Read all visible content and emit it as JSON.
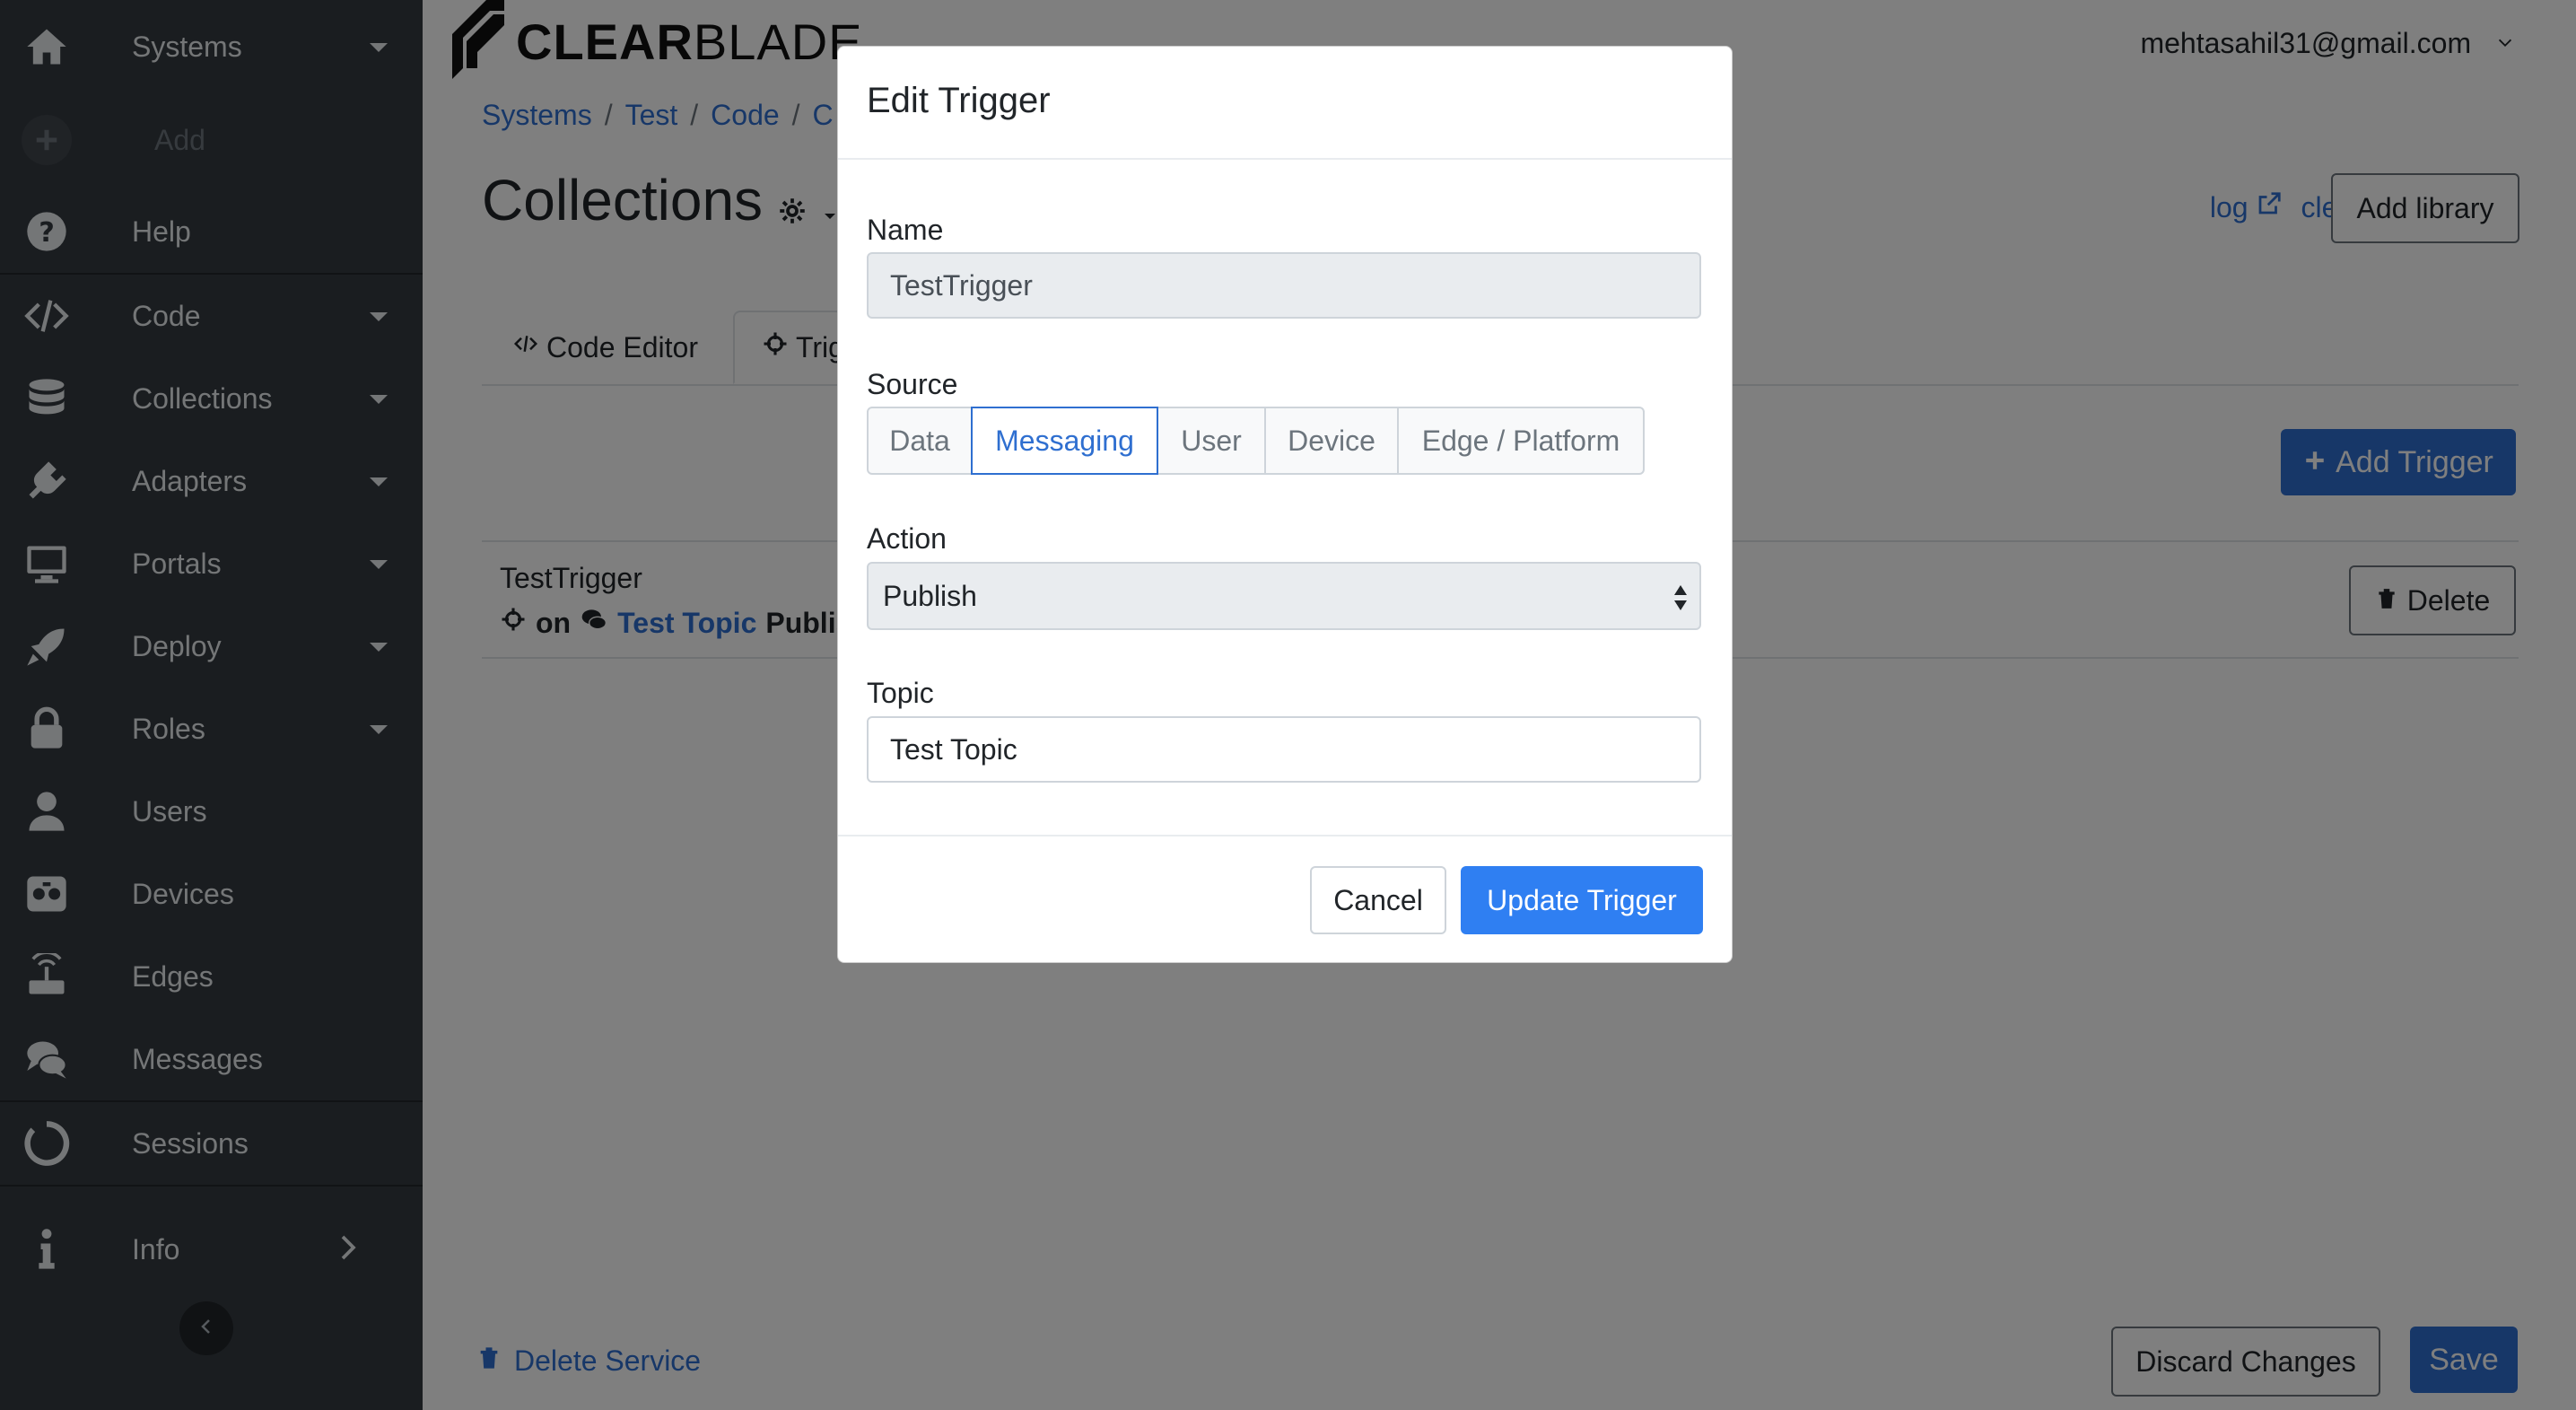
{
  "sidebar": {
    "items": [
      {
        "label": "Systems",
        "icon": "home-icon"
      },
      {
        "label": "Add",
        "icon": "plus-circle-icon"
      },
      {
        "label": "Help",
        "icon": "question-circle-icon"
      },
      {
        "label": "Code",
        "icon": "code-icon"
      },
      {
        "label": "Collections",
        "icon": "database-icon"
      },
      {
        "label": "Adapters",
        "icon": "plug-icon"
      },
      {
        "label": "Portals",
        "icon": "monitor-icon"
      },
      {
        "label": "Deploy",
        "icon": "rocket-icon"
      },
      {
        "label": "Roles",
        "icon": "lock-icon"
      },
      {
        "label": "Users",
        "icon": "user-icon"
      },
      {
        "label": "Devices",
        "icon": "device-icon"
      },
      {
        "label": "Edges",
        "icon": "router-icon"
      },
      {
        "label": "Messages",
        "icon": "chat-icon"
      },
      {
        "label": "Sessions",
        "icon": "circle-notch-icon"
      },
      {
        "label": "Info",
        "icon": "info-icon"
      }
    ]
  },
  "header": {
    "logo_bold": "CLEAR",
    "logo_light": "BLADE",
    "user_email": "mehtasahil31@gmail.com"
  },
  "breadcrumb": [
    "Systems",
    "Test",
    "Code",
    "C"
  ],
  "page": {
    "title": "Collections",
    "log_link": "log",
    "clearblade_link": "clearblade",
    "add_library": "Add library"
  },
  "tabs": {
    "code_editor": "Code Editor",
    "triggers": "Trig"
  },
  "trigger_list": {
    "add_trigger": "Add Trigger",
    "row": {
      "name": "TestTrigger",
      "on": "on",
      "topic": "Test Topic",
      "action": "Publis",
      "delete": "Delete"
    }
  },
  "footer": {
    "delete_service": "Delete Service",
    "discard": "Discard Changes",
    "save": "Save"
  },
  "modal": {
    "title": "Edit Trigger",
    "name_label": "Name",
    "name_value": "TestTrigger",
    "source_label": "Source",
    "sources": [
      "Data",
      "Messaging",
      "User",
      "Device",
      "Edge / Platform"
    ],
    "selected_source": "Messaging",
    "action_label": "Action",
    "action_value": "Publish",
    "topic_label": "Topic",
    "topic_value": "Test Topic",
    "cancel": "Cancel",
    "update": "Update Trigger"
  },
  "colors": {
    "sidebar_bg": "#343a40",
    "link": "#2f6fd0",
    "primary": "#2f7ff2"
  }
}
